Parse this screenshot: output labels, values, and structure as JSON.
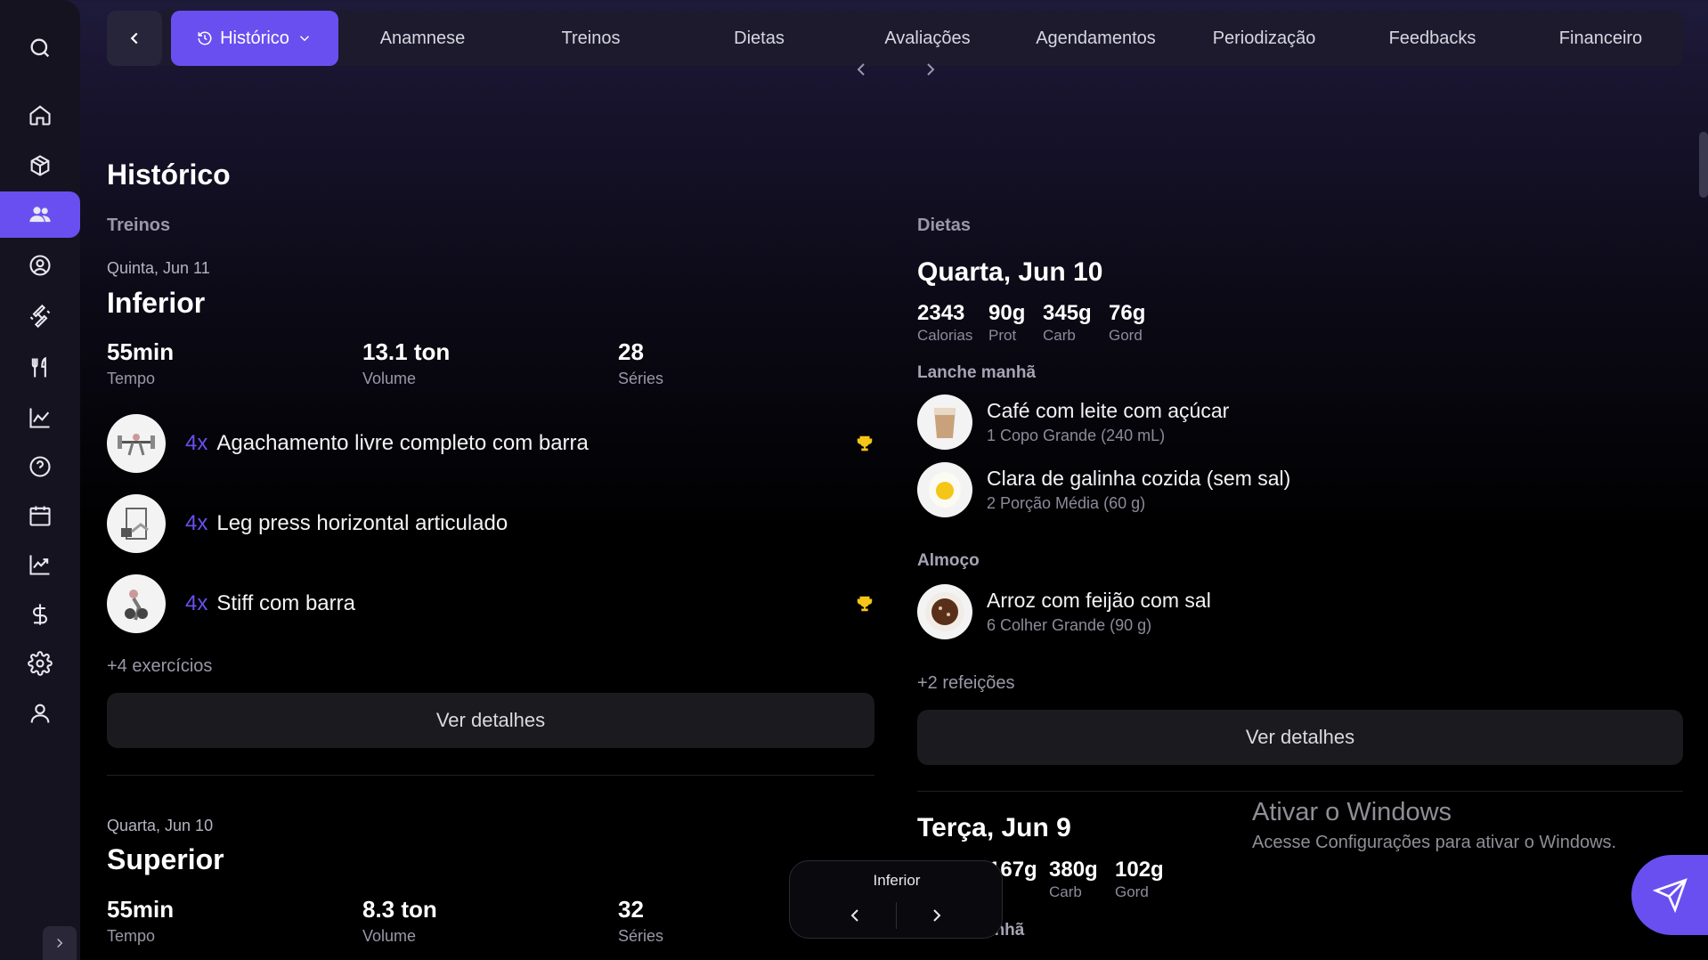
{
  "sidebar": {
    "icons": [
      "search-icon",
      "home-icon",
      "box-icon",
      "users-icon",
      "user-circle-icon",
      "dumbbell-icon",
      "fork-knife-icon",
      "line-chart-icon",
      "help-icon",
      "calendar-icon",
      "trend-chart-icon",
      "dollar-icon",
      "settings-icon",
      "user-icon"
    ],
    "active": "users-icon",
    "accent": "#6a4ff0"
  },
  "tabs": {
    "active_label": "Histórico",
    "items": [
      "Anamnese",
      "Treinos",
      "Dietas",
      "Avaliações",
      "Agendamentos",
      "Periodização",
      "Feedbacks",
      "Financeiro"
    ]
  },
  "page": {
    "title": "Histórico",
    "workouts_label": "Treinos",
    "diets_label": "Dietas"
  },
  "workouts": [
    {
      "date": "Quinta, Jun 11",
      "name": "Inferior",
      "stats": [
        {
          "value": "55min",
          "label": "Tempo"
        },
        {
          "value": "13.1 ton",
          "label": "Volume"
        },
        {
          "value": "28",
          "label": "Séries"
        }
      ],
      "exercises": [
        {
          "sets": "4x",
          "name": "Agachamento livre completo com barra",
          "trophy": true
        },
        {
          "sets": "4x",
          "name": "Leg press horizontal articulado",
          "trophy": false
        },
        {
          "sets": "4x",
          "name": "Stiff com barra",
          "trophy": true
        }
      ],
      "more": "+4 exercícios",
      "details_button": "Ver detalhes"
    },
    {
      "date": "Quarta, Jun 10",
      "name": "Superior",
      "stats": [
        {
          "value": "55min",
          "label": "Tempo"
        },
        {
          "value": "8.3 ton",
          "label": "Volume"
        },
        {
          "value": "32",
          "label": "Séries"
        }
      ]
    }
  ],
  "diets": [
    {
      "date": "Quarta, Jun 10",
      "macros": [
        {
          "value": "2343",
          "label": "Calorias"
        },
        {
          "value": "90g",
          "label": "Prot"
        },
        {
          "value": "345g",
          "label": "Carb"
        },
        {
          "value": "76g",
          "label": "Gord"
        }
      ],
      "meals": [
        {
          "title": "Lanche manhã",
          "foods": [
            {
              "name": "Café com leite com açúcar",
              "portion": "1 Copo Grande (240 mL)"
            },
            {
              "name": "Clara de galinha cozida (sem sal)",
              "portion": "2 Porção Média (60 g)"
            }
          ]
        },
        {
          "title": "Almoço",
          "foods": [
            {
              "name": "Arroz com feijão com sal",
              "portion": "6 Colher Grande (90 g)"
            }
          ]
        }
      ],
      "more": "+2 refeições",
      "details_button": "Ver detalhes"
    },
    {
      "date": "Terça, Jun 9",
      "macros_visible": [
        {
          "value": "167g",
          "label": "ot"
        },
        {
          "value": "380g",
          "label": "Carb"
        },
        {
          "value": "102g",
          "label": "Gord"
        }
      ],
      "meal_title_partial": "anhã"
    }
  ],
  "floating_nav": {
    "label": "Inferior"
  },
  "watermark": {
    "title": "Ativar o Windows",
    "subtitle": "Acesse Configurações para ativar o Windows."
  }
}
